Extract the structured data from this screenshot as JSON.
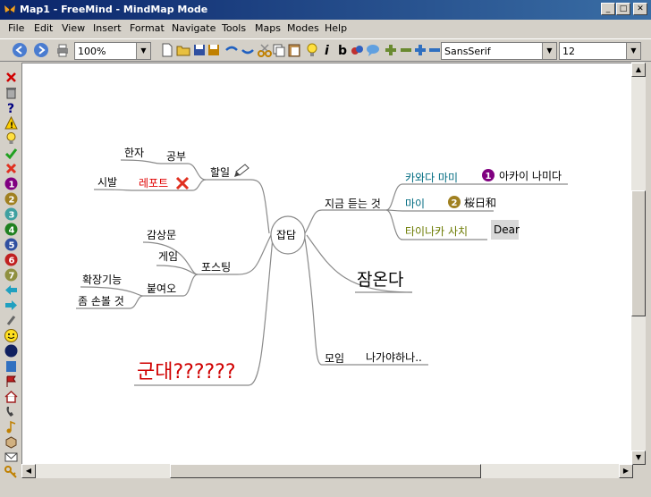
{
  "window": {
    "title": "Map1 - FreeMind - MindMap Mode"
  },
  "menu": [
    "File",
    "Edit",
    "View",
    "Insert",
    "Format",
    "Navigate",
    "Tools",
    "Maps",
    "Modes",
    "Help"
  ],
  "toolbar": {
    "zoom": "100%",
    "font": "SansSerif",
    "size": "12"
  },
  "mindmap": {
    "root": "잡담",
    "left": {
      "halil": "할일",
      "gongbu": "공부",
      "hanja": "한자",
      "report": "레포트",
      "sibal": "시발",
      "posting": "포스팅",
      "gamsangmun": "감상문",
      "game": "게임",
      "buryeo": "붙여오",
      "hwakjang": "확장기능",
      "jom": "좀 손볼 것",
      "gundae": "군대??????"
    },
    "right": {
      "jigeum": "지금 듣는 것",
      "kawada": "카와다 마미",
      "akai": "아카이 나미다",
      "mai": "마이",
      "sakura": "桜日和",
      "tainaka": "타이나카 사치",
      "dear": "Dear",
      "jam": "잠온다",
      "moim": "모임",
      "nagaya": "나가야하나.."
    },
    "badges": {
      "one": "1",
      "two": "2"
    }
  },
  "colors": {
    "accent_teal": "#006b80",
    "accent_olive": "#6b7a00",
    "accent_red": "#e00000",
    "edge": "#8a8a8a"
  }
}
